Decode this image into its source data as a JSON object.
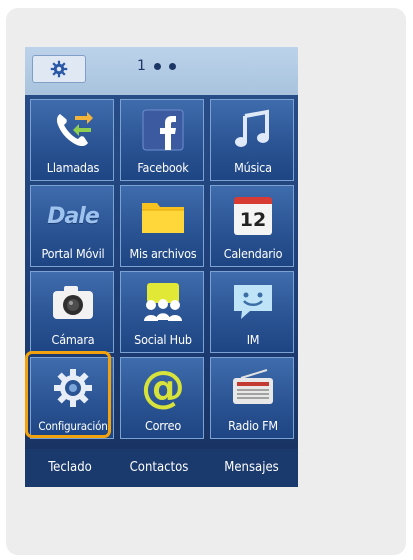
{
  "home": {
    "page_indicator": "1",
    "page_dots": 3
  },
  "apps": [
    {
      "label": "Llamadas",
      "icon": "phone-icon"
    },
    {
      "label": "Facebook",
      "icon": "facebook-icon"
    },
    {
      "label": "Música",
      "icon": "music-note-icon"
    },
    {
      "label": "Portal Móvil",
      "icon": "dale-logo-icon"
    },
    {
      "label": "Mis archivos",
      "icon": "folder-icon"
    },
    {
      "label": "Calendario",
      "icon": "calendar-icon"
    },
    {
      "label": "Cámara",
      "icon": "camera-icon"
    },
    {
      "label": "Social Hub",
      "icon": "people-icon"
    },
    {
      "label": "IM",
      "icon": "chat-smiley-icon"
    },
    {
      "label": "Configuración",
      "icon": "gear-icon"
    },
    {
      "label": "Correo",
      "icon": "at-sign-icon"
    },
    {
      "label": "Radio FM",
      "icon": "radio-icon"
    }
  ],
  "calendar_icon_day": "12",
  "dale_logo_text": "Dale",
  "bottom_tabs": [
    {
      "label": "Teclado"
    },
    {
      "label": "Contactos"
    },
    {
      "label": "Mensajes"
    }
  ],
  "colors": {
    "highlight": "#f2a20c",
    "tile_blue": "#2b5494",
    "topbar": "#bcd3ea"
  }
}
